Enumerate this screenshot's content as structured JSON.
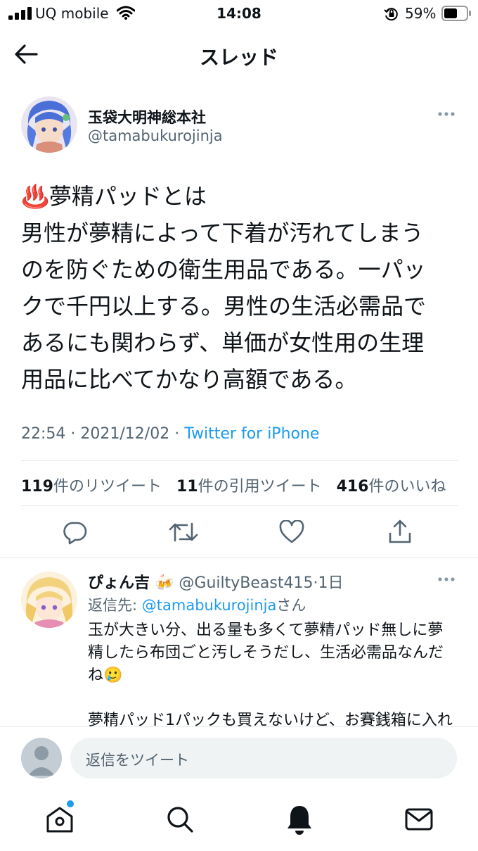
{
  "status_bar": {
    "carrier": "UQ mobile",
    "time": "14:08",
    "battery_percent": "59%",
    "signal_bars": 4,
    "battery_level": 0.59
  },
  "header": {
    "back_icon": "arrow-left-icon",
    "title": "スレッド"
  },
  "tweet": {
    "author_name": "玉袋大明神総本社",
    "author_handle": "@tamabukurojinja",
    "more_icon": "more-horizontal-icon",
    "text_lines": [
      "♨️夢精パッドとは",
      "男性が夢精によって下着が汚れてしまう",
      "のを防ぐための衛生用品である。一パッ",
      "クで千円以上する。男性の生活必需品で",
      "あるにも関わらず、単価が女性用の生理",
      "用品に比べてかなり高額である。"
    ],
    "time": "22:54",
    "date": "2021/12/02",
    "source": "Twitter for iPhone",
    "stats": {
      "retweets_count": "119",
      "retweets_label": "件のリツイート",
      "quotes_count": "11",
      "quotes_label": "件の引用ツイート",
      "likes_count": "416",
      "likes_label": "件のいいね"
    },
    "actions": [
      "reply-icon",
      "retweet-icon",
      "like-icon",
      "share-icon"
    ]
  },
  "reply": {
    "author_name": "ぴょん吉",
    "author_emoji": "🍻",
    "author_handle": "@GuiltyBeast415",
    "time_ago": "1日",
    "reply_to_prefix": "返信先: ",
    "reply_to_handle": "@tamabukurojinja",
    "reply_to_suffix": "さん",
    "text_lines": [
      "玉が大きい分、出る量も多くて夢精パッド無しに夢",
      "精したら布団ごと汚しそうだし、生活必需品なんだ",
      "ね🥲",
      "",
      "夢精パッド1パックも買えないけど、お賽銭箱に入れ"
    ]
  },
  "composer": {
    "placeholder": "返信をツイート"
  },
  "tab_bar": {
    "items": [
      "home-icon",
      "search-icon",
      "notifications-icon",
      "messages-icon"
    ],
    "home_has_notification": true
  }
}
